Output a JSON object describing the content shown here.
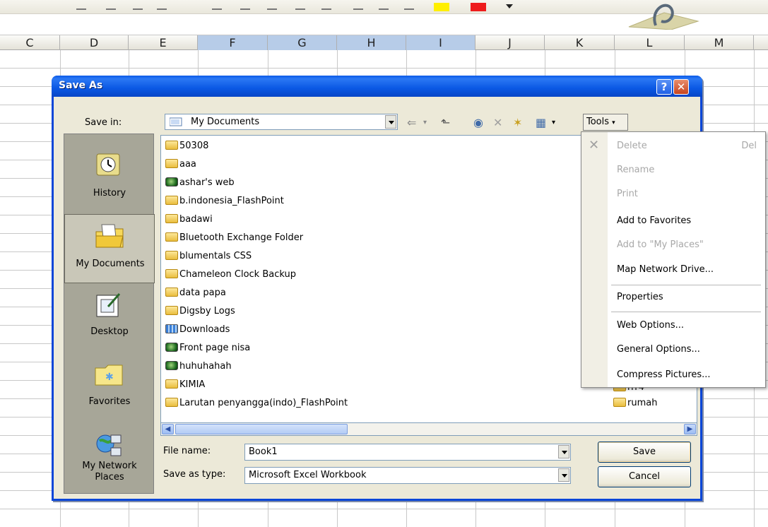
{
  "columns": [
    {
      "label": "C",
      "selected": false
    },
    {
      "label": "D",
      "selected": false
    },
    {
      "label": "E",
      "selected": false
    },
    {
      "label": "F",
      "selected": true
    },
    {
      "label": "G",
      "selected": true
    },
    {
      "label": "H",
      "selected": true
    },
    {
      "label": "I",
      "selected": true
    },
    {
      "label": "J",
      "selected": false
    },
    {
      "label": "K",
      "selected": false
    },
    {
      "label": "L",
      "selected": false
    },
    {
      "label": "M",
      "selected": false
    }
  ],
  "colors": {
    "highlight": "#ffef00",
    "font_color": "#ee1c1c",
    "title_blue": "#0a58e4"
  },
  "dialog": {
    "title": "Save As",
    "help_icon": "help-icon",
    "close_icon": "close-icon",
    "save_in_label": "Save in:",
    "save_in_value": "My Documents",
    "tools_label": "Tools"
  },
  "places": [
    {
      "label": "History",
      "icon": "history-icon",
      "active": false
    },
    {
      "label": "My Documents",
      "icon": "my-documents-icon",
      "active": true
    },
    {
      "label": "Desktop",
      "icon": "desktop-icon",
      "active": false
    },
    {
      "label": "Favorites",
      "icon": "favorites-icon",
      "active": false
    },
    {
      "label_line1": "My Network",
      "label_line2": "Places",
      "icon": "network-places-icon",
      "active": false
    }
  ],
  "files": [
    {
      "name": "50308",
      "icon": "folder"
    },
    {
      "name": "aaa",
      "icon": "folder"
    },
    {
      "name": "ashar's web",
      "icon": "web"
    },
    {
      "name": "b.indonesia_FlashPoint",
      "icon": "folder"
    },
    {
      "name": "badawi",
      "icon": "folder"
    },
    {
      "name": "Bluetooth Exchange Folder",
      "icon": "folder"
    },
    {
      "name": "blumentals CSS",
      "icon": "folder"
    },
    {
      "name": "Chameleon Clock Backup",
      "icon": "folder"
    },
    {
      "name": "data papa",
      "icon": "folder"
    },
    {
      "name": "Digsby Logs",
      "icon": "folder"
    },
    {
      "name": "Downloads",
      "icon": "downloads"
    },
    {
      "name": "Front page nisa",
      "icon": "web"
    },
    {
      "name": "huhuhahah",
      "icon": "web"
    },
    {
      "name": "KIMIA",
      "icon": "folder"
    },
    {
      "name": "Larutan penyangga(indo)_FlashPoint",
      "icon": "folder"
    }
  ],
  "files_right": [
    {
      "name": "rrr4",
      "icon": "folder"
    },
    {
      "name": "rumah",
      "icon": "folder"
    }
  ],
  "file_name": {
    "label": "File name:",
    "value": "Book1"
  },
  "save_as_type": {
    "label": "Save as type:",
    "value": "Microsoft Excel Workbook"
  },
  "buttons": {
    "save": "Save",
    "cancel": "Cancel"
  },
  "tools_menu": {
    "items": [
      {
        "label": "Delete",
        "shortcut": "Del",
        "disabled": true
      },
      {
        "label": "Rename",
        "disabled": true
      },
      {
        "label": "Print",
        "disabled": true
      },
      {
        "label": "Add to Favorites",
        "disabled": false
      },
      {
        "label": "Add to \"My Places\"",
        "disabled": true
      },
      {
        "label": "Map Network Drive...",
        "disabled": false
      },
      {
        "label": "Properties",
        "disabled": false
      },
      {
        "label": "Web Options...",
        "disabled": false
      },
      {
        "label": "General Options...",
        "disabled": false
      },
      {
        "label": "Compress Pictures...",
        "disabled": false
      }
    ]
  }
}
